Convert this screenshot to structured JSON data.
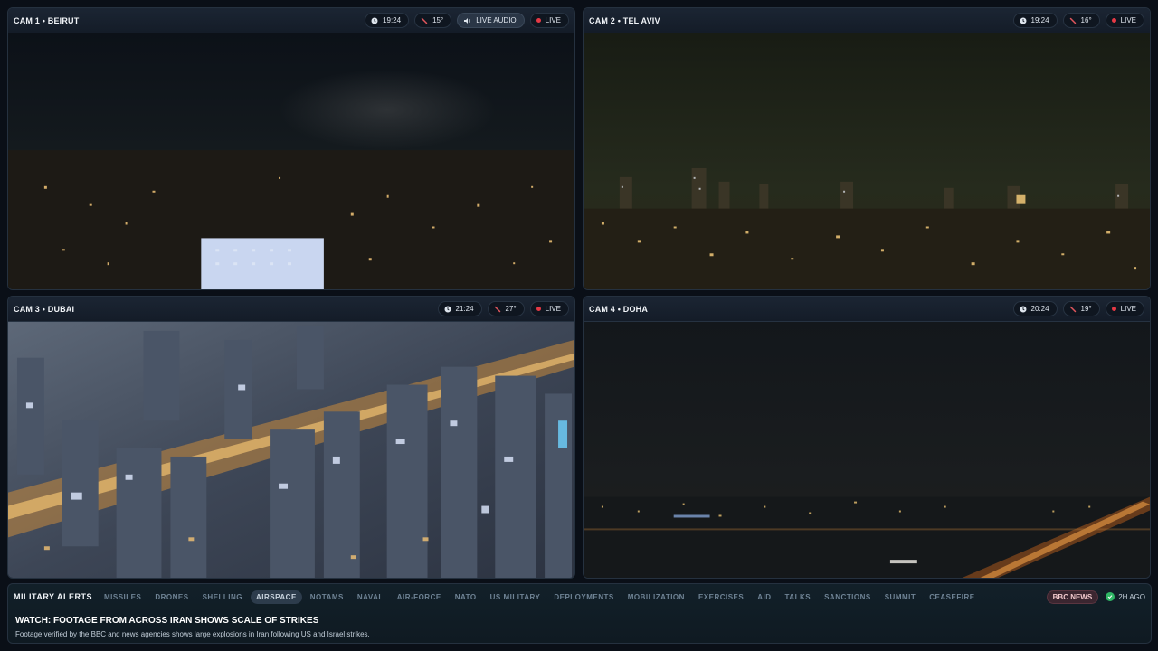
{
  "cams": [
    {
      "title": "CAM 1 • BEIRUT",
      "time": "19:24",
      "temp": "15°",
      "audio": "LIVE AUDIO",
      "live": "LIVE"
    },
    {
      "title": "CAM 2 • TEL AVIV",
      "time": "19:24",
      "temp": "16°",
      "live": "LIVE"
    },
    {
      "title": "CAM 3 • DUBAI",
      "time": "21:24",
      "temp": "27°",
      "live": "LIVE"
    },
    {
      "title": "CAM 4 • DOHA",
      "time": "20:24",
      "temp": "19°",
      "live": "LIVE"
    }
  ],
  "alerts": {
    "title": "MILITARY ALERTS",
    "tags": [
      "MISSILES",
      "DRONES",
      "SHELLING",
      "AIRSPACE",
      "NOTAMS",
      "NAVAL",
      "AIR-FORCE",
      "NATO",
      "US MILITARY",
      "DEPLOYMENTS",
      "MOBILIZATION",
      "EXERCISES",
      "AID",
      "TALKS",
      "SANCTIONS",
      "SUMMIT",
      "CEASEFIRE"
    ],
    "active_tag": "AIRSPACE",
    "source": "BBC NEWS",
    "ago": "2H AGO",
    "headline": "WATCH: FOOTAGE FROM ACROSS IRAN SHOWS SCALE OF STRIKES",
    "summary": "Footage verified by the BBC and news agencies shows large explosions in Iran following US and Israel strikes."
  },
  "colors": {
    "live_dot": "#e53945",
    "accent": "#2fb765",
    "source_badge": "#3b2630"
  }
}
